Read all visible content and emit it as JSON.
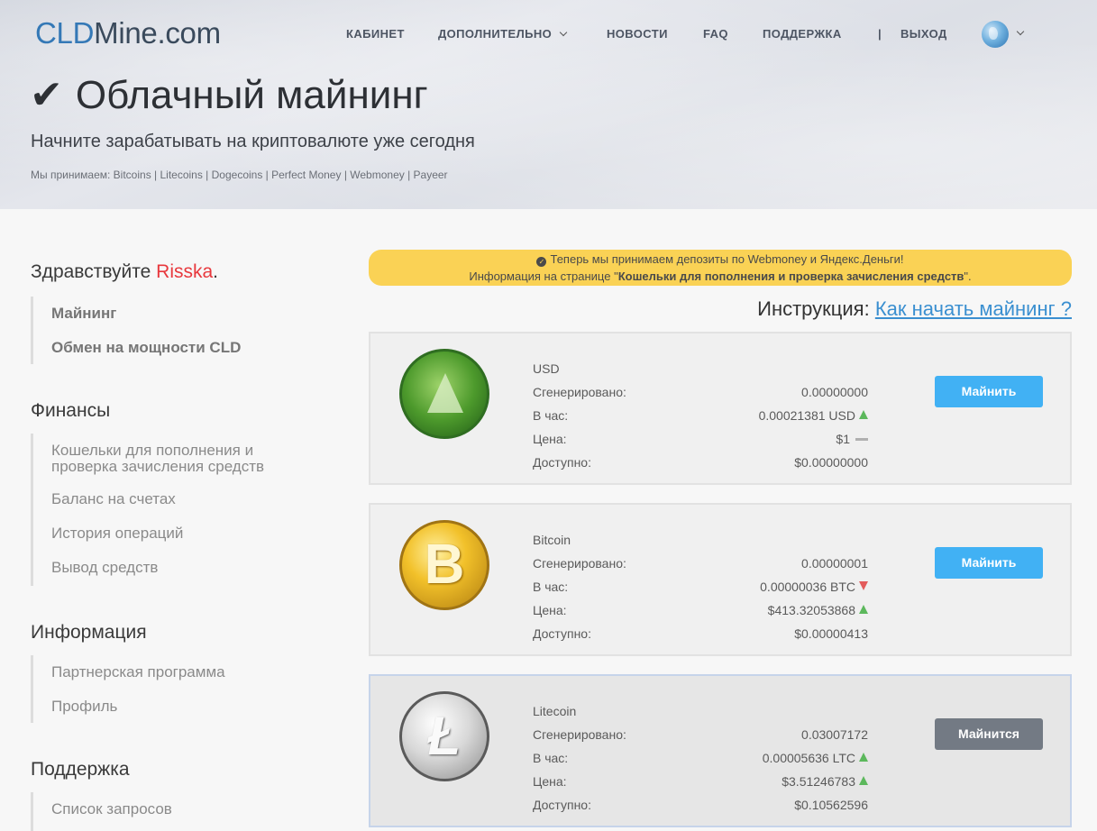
{
  "logo": {
    "part1": "CLD",
    "part2": "Mine.com"
  },
  "nav": {
    "items": [
      "КАБИНЕТ",
      "ДОПОЛНИТЕЛЬНО",
      "НОВОСТИ",
      "FAQ",
      "ПОДДЕРЖКА"
    ],
    "sep": "|",
    "logout": "ВЫХОД"
  },
  "hero": {
    "check": "✔",
    "title": "Облачный майнинг",
    "subtitle": "Начните зарабатывать на криптовалюте уже сегодня",
    "accept": "Мы принимаем: Bitcoins | Litecoins | Dogecoins | Perfect Money | Webmoney | Payeer"
  },
  "sidebar": {
    "greeting": "Здравствуйте ",
    "username": "Risska",
    "greeting_end": ".",
    "mining_menu": [
      "Майнинг",
      "Обмен на мощности CLD"
    ],
    "finance_title": "Финансы",
    "finance_menu": [
      "Кошельки для пополнения и",
      "проверка зачисления средств",
      "Баланс на счетах",
      "История операций",
      "Вывод средств"
    ],
    "info_title": "Информация",
    "info_menu": [
      "Партнерская программа",
      "Профиль"
    ],
    "support_title": "Поддержка",
    "support_menu": [
      "Список запросов"
    ]
  },
  "notice": {
    "line1": "Теперь мы принимаем депозиты по Webmoney и Яндекс.Деньги!",
    "line2_pre": "Информация на странице \"",
    "line2_bold": "Кошельки для пополнения и проверка зачисления средств",
    "line2_post": "\"."
  },
  "instruction": {
    "label": "Инструкция: ",
    "link": "Как начать майнинг ?"
  },
  "labels": {
    "generated": "Сгенерировано:",
    "per_hour": "В час:",
    "price": "Цена:",
    "available": "Доступно:"
  },
  "coins": [
    {
      "name": "USD",
      "generated": "0.00000000",
      "per_hour": "0.00021381 USD",
      "per_hour_trend": "up",
      "price": "$1",
      "price_trend": "flat",
      "available": "$0.00000000",
      "button": "Майнить",
      "active": false
    },
    {
      "name": "Bitcoin",
      "generated": "0.00000001",
      "per_hour": "0.00000036 BTC",
      "per_hour_trend": "down",
      "price": "$413.32053868",
      "price_trend": "up",
      "available": "$0.00000413",
      "button": "Майнить",
      "active": false
    },
    {
      "name": "Litecoin",
      "generated": "0.03007172",
      "per_hour": "0.00005636 LTC",
      "per_hour_trend": "up",
      "price": "$3.51246783",
      "price_trend": "up",
      "available": "$0.10562596",
      "button": "Майнится",
      "active": true
    }
  ],
  "coin_glyphs": {
    "btc": "B",
    "ltc": "Ł"
  },
  "colors": {
    "accent_blue": "#41b1f4",
    "busy_gray": "#737a84",
    "notice_yellow": "#fad255",
    "user_red": "#e8383d",
    "up_green": "#5cb85c",
    "down_red": "#e35b5b"
  }
}
